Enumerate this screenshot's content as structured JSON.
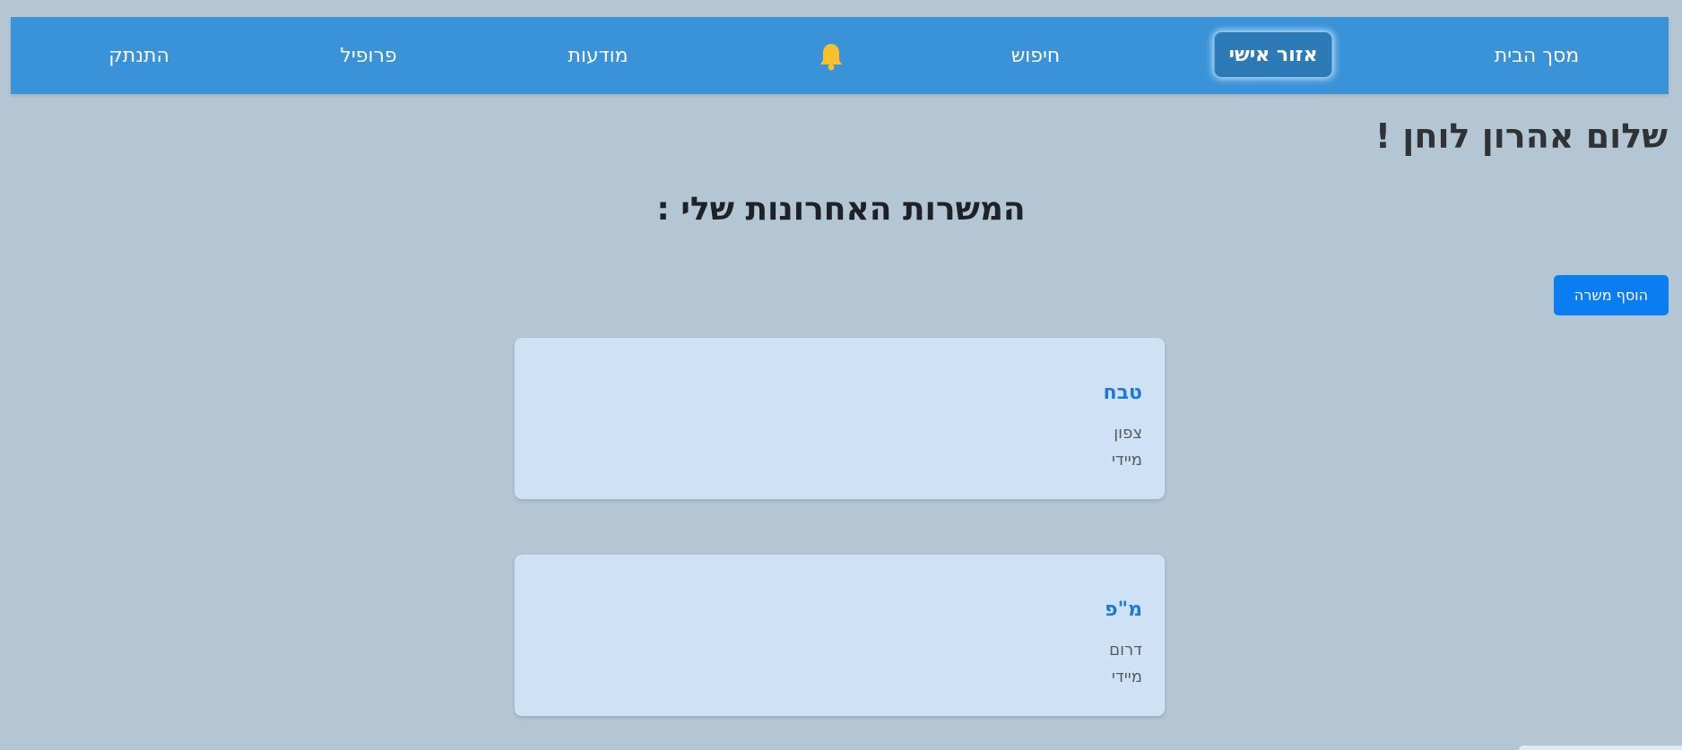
{
  "nav": {
    "home": "מסך הבית",
    "personal_area": "אזור אישי",
    "search": "חיפוש",
    "notifications_icon": "bell-icon",
    "ads": "מודעות",
    "profile": "פרופיל",
    "logout": "התנתק"
  },
  "greeting": "שלום אהרון לוחן !",
  "section_title": "המשרות האחרונות שלי :",
  "add_job_label": "הוסף משרה",
  "jobs": [
    {
      "title": "טבח",
      "region": "צפון",
      "start": "מיידי"
    },
    {
      "title": "מ\"פ",
      "region": "דרום",
      "start": "מיידי"
    }
  ],
  "colors": {
    "background": "#b4c6d4",
    "navbar": "#3a93d8",
    "active_tab": "#2c7ab6",
    "bell": "#f6c12c",
    "button": "#0a7df2",
    "card": "#cfe2f5",
    "job_title": "#1f7ad6"
  }
}
